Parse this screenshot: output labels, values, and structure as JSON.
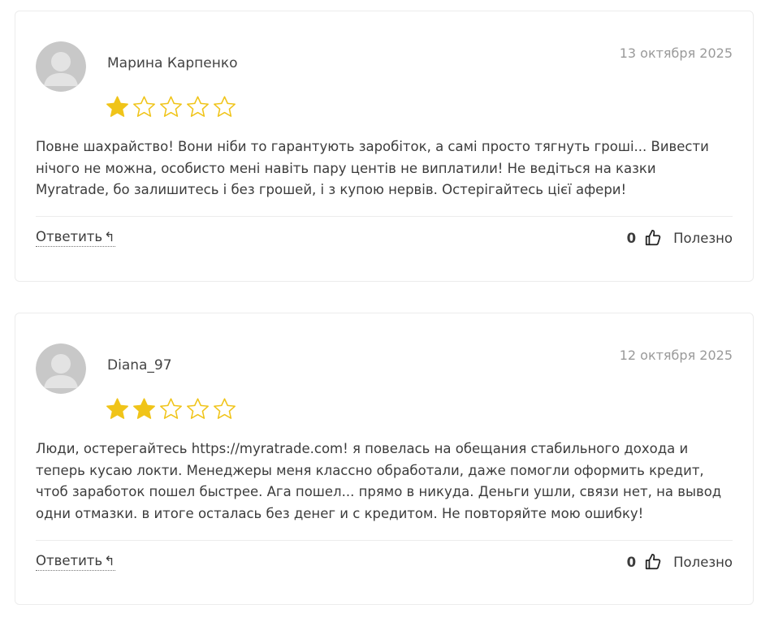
{
  "colors": {
    "star_filled": "#f0c419",
    "star_outline": "#f0c419",
    "avatar_bg": "#c8c8c8",
    "avatar_figure": "#e3e3e3"
  },
  "reviews": [
    {
      "author": "Марина Карпенко",
      "date": "13 октября 2025",
      "rating": 1,
      "text": "Повне шахрайство! Вони ніби то гарантують заробіток, а самі просто тягнуть гроші... Вивести нічого не можна, особисто мені навіть пару центів не виплатили! Не ведіться на казки Myratrade, бо залишитесь і без грошей, і з купою нервів. Остерігайтесь цієї афери!",
      "reply_label": "Ответить",
      "reply_icon": "reply-arrow-icon",
      "likes": "0",
      "helpful_label": "Полезно"
    },
    {
      "author": "Diana_97",
      "date": "12 октября 2025",
      "rating": 2,
      "text": "Люди, остерегайтесь https://myratrade.com! я повелась на обещания стабильного дохода и теперь кусаю локти. Менеджеры меня классно обработали, даже помогли оформить кредит, чтоб заработок пошел быстрее. Ага пошел... прямо в никуда. Деньги ушли, связи нет, на вывод одни отмазки. в итоге осталась без денег и с кредитом. Не повторяйте мою ошибку!",
      "reply_label": "Ответить",
      "reply_icon": "reply-arrow-icon",
      "likes": "0",
      "helpful_label": "Полезно"
    }
  ]
}
